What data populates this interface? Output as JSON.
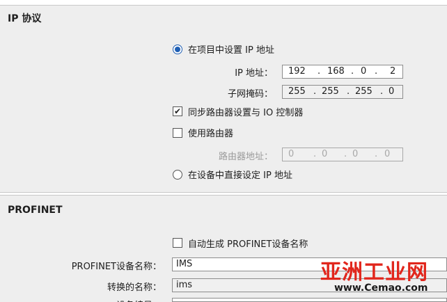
{
  "ip_section": {
    "title": "IP 协议",
    "radio_set_in_project": "在项目中设置 IP 地址",
    "ip_label": "IP 地址：",
    "ip_octets": [
      "192",
      "168",
      "0",
      "2"
    ],
    "subnet_label": "子网掩码：",
    "subnet_octets": [
      "255",
      "255",
      "255",
      "0"
    ],
    "sync_router_label": "同步路由器设置与 IO 控制器",
    "use_router_label": "使用路由器",
    "router_addr_label": "路由器地址：",
    "router_octets": [
      "0",
      "0",
      "0",
      "0"
    ],
    "radio_set_on_device": "在设备中直接设定 IP 地址"
  },
  "profinet_section": {
    "title": "PROFINET",
    "auto_name_label": "自动生成 PROFINET设备名称",
    "device_name_label": "PROFINET设备名称：",
    "device_name_value": "IMS",
    "converted_name_label": "转换的名称：",
    "converted_name_value": "ims",
    "device_number_label": "设备编号："
  },
  "watermark": {
    "brand": "亚洲工业网",
    "url": "www.Cemao.com"
  },
  "colors": {
    "accent": "#1f5fb4",
    "watermark_red": "#e1261c"
  }
}
